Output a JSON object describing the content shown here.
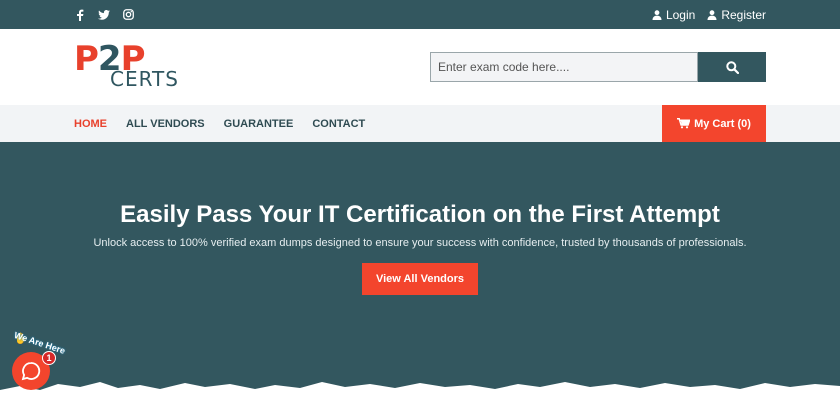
{
  "topbar": {
    "social": [
      "facebook-icon",
      "twitter-icon",
      "instagram-icon"
    ],
    "login_label": "Login",
    "register_label": "Register"
  },
  "logo": {
    "top": "P2P",
    "bottom": "CERTS"
  },
  "search": {
    "placeholder": "Enter exam code here...."
  },
  "nav": {
    "items": [
      {
        "label": "HOME",
        "active": true
      },
      {
        "label": "ALL VENDORS"
      },
      {
        "label": "GUARANTEE"
      },
      {
        "label": "CONTACT"
      }
    ],
    "cart_label": "My Cart (0)"
  },
  "hero": {
    "title": "Easily Pass Your IT Certification on the First Attempt",
    "subtitle": "Unlock access to 100% verified exam dumps designed to ensure your success with confidence, trusted by thousands of professionals.",
    "cta_label": "View All Vendors"
  },
  "chat_widget": {
    "label": "We Are Here",
    "badge_count": "1"
  },
  "colors": {
    "primary": "#33575f",
    "accent": "#f3452d",
    "nav_bg": "#f2f4f6",
    "logo_red": "#e8412c"
  }
}
